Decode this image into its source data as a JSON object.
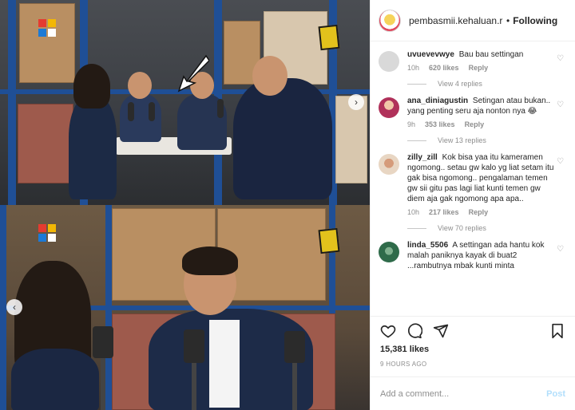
{
  "post": {
    "username": "pembasmii.kehaluan.re",
    "follow_label": "Following",
    "likes": "15,381 likes",
    "time_ago": "9 HOURS AGO",
    "comment_placeholder": "Add a comment...",
    "post_label": "Post"
  },
  "comments": [
    {
      "user": "uvuevevwye",
      "text": "Bau bau settingan",
      "age": "10h",
      "likes": "620 likes",
      "reply": "Reply",
      "view_replies": "View 4 replies",
      "avatar_color": "#d9d9d9"
    },
    {
      "user": "ana_diniagustin",
      "text": "Setingan atau bukan.. yang penting seru aja nonton nya 😂",
      "age": "9h",
      "likes": "353 likes",
      "reply": "Reply",
      "view_replies": "View 13 replies",
      "avatar_color": "#b0315a"
    },
    {
      "user": "zilly_zill",
      "text": "Kok bisa yaa itu kameramen ngomong.. setau gw kalo yg liat setam itu gak bisa ngomong.. pengalaman temen gw sii gitu pas lagi liat kunti temen gw diem aja gak ngomong apa apa..",
      "age": "10h",
      "likes": "217 likes",
      "reply": "Reply",
      "view_replies": "View 70 replies",
      "avatar_color": "#e8d6c3"
    },
    {
      "user": "linda_5506",
      "text": "A settingan ada hantu kok malah paniknya kayak di buat2 ...rambutnya mbak kunti minta",
      "age": "",
      "likes": "",
      "reply": "",
      "view_replies": "",
      "avatar_color": "#2f6b4a"
    }
  ],
  "icons": {
    "carousel_next": "chevron-right-icon",
    "carousel_prev": "chevron-left-icon",
    "like": "heart-icon",
    "comment": "comment-icon",
    "share": "paper-plane-icon",
    "save": "bookmark-icon"
  },
  "colors": {
    "accent_blue": "#0095f6",
    "post_disabled": "#b2dffc",
    "muted_text": "#8e8e8e"
  }
}
